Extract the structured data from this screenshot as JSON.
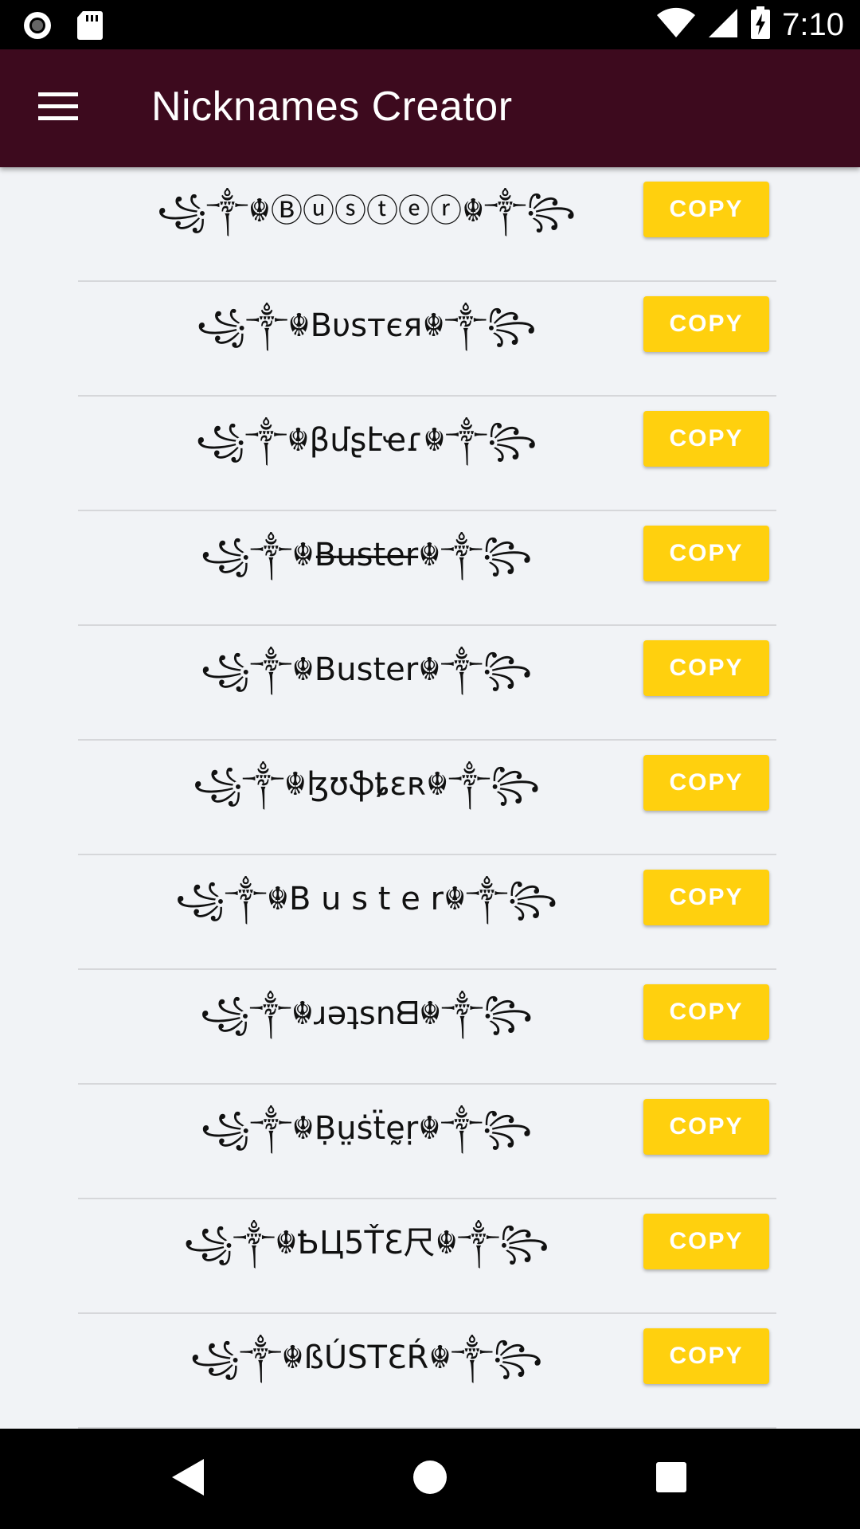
{
  "status_bar": {
    "time": "7:10",
    "icons": [
      "record-icon",
      "sd-card-icon",
      "wifi-icon",
      "signal-icon",
      "battery-charging-icon"
    ]
  },
  "app_bar": {
    "title": "Nicknames Creator",
    "menu_icon": "menu-icon"
  },
  "list": {
    "copy_label": "COPY",
    "items": [
      "꧁༒☬Ⓑⓤⓢⓣⓔⓡ☬༒꧂",
      "꧁༒☬Bυsтєя☬༒꧂",
      "꧁༒☬βմʂէҽɾ☬༒꧂",
      "꧁༒☬B̶u̶s̶t̶e̶r̶☬༒꧂",
      "꧁༒☬Buster☬༒꧂",
      "꧁༒☬ɮʊֆȶɛʀ☬༒꧂",
      "꧁༒☬B u s t e r☬༒꧂",
      "꧁༒☬ɹǝʇsnᗺ☬༒꧂",
      "꧁༒☬Ḅṳṡẗḛṛ☬༒꧂",
      "꧁༒☬ҌЦ5ŤƐ尺☬༒꧂",
      "꧁༒☬ßÚSTƐŔ☬༒꧂"
    ]
  },
  "nav_bar": {
    "icons": [
      "back-icon",
      "home-icon",
      "recents-icon"
    ]
  }
}
